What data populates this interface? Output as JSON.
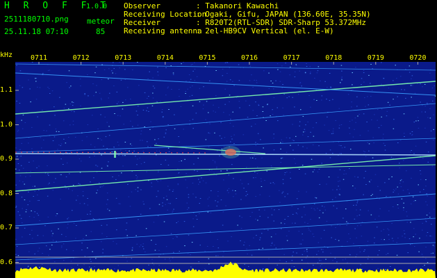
{
  "header": {
    "app_title": "H R O F F T",
    "app_version": "1.0.0",
    "filename": "2511180710.png",
    "meteor_label": "meteor",
    "datetime": "25.11.18 07:10",
    "meteor_count": "85",
    "info": [
      {
        "key": "Observer",
        "value": ": Takanori Kawachi"
      },
      {
        "key": "Receiving Location",
        "value": ": Ogaki, Gifu, JAPAN (136.60E, 35.35N)"
      },
      {
        "key": "Receiver",
        "value": ": R820T2(RTL-SDR) SDR-Sharp 53.372MHz"
      },
      {
        "key": "Receiving antenna",
        "value": ": 2el-HB9CV Vertical (el. E-W)"
      }
    ]
  },
  "spectrogram": {
    "y_unit": "kHz",
    "y_ticks": [
      "1.1",
      "1.0",
      "0.9",
      "0.8",
      "0.7",
      "0.6"
    ],
    "x_ticks": [
      "0711",
      "0712",
      "0713",
      "0714",
      "0715",
      "0716",
      "0717",
      "0718",
      "0719",
      "0720"
    ],
    "colors": {
      "background": "#0a1a8a",
      "trace": "#7fffb0",
      "trace_faint": "#3aa0ff",
      "signal": "#ff4040",
      "grid": "#aaaaaa",
      "noise_floor": "#ffff00",
      "label": "#ffff00"
    }
  }
}
